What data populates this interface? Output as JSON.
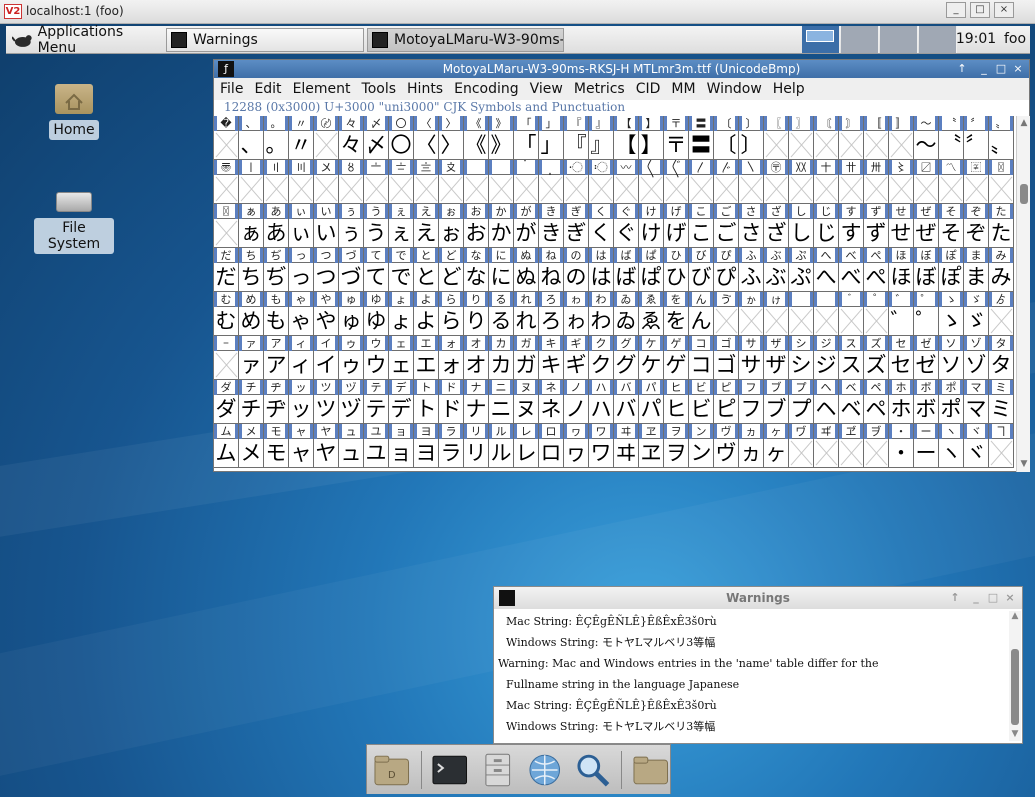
{
  "vnc": {
    "title": "localhost:1 (foo)",
    "logo": "V2"
  },
  "panel": {
    "apps_label": "Applications Menu",
    "tasks": [
      {
        "label": "Warnings"
      },
      {
        "label": "MotoyaLMaru-W3-90ms-…"
      }
    ],
    "clock": "19:01",
    "user": "foo"
  },
  "desktop_icons": [
    {
      "label": "Home"
    },
    {
      "label": "File System"
    }
  ],
  "font_window": {
    "title": "MotoyaLMaru-W3-90ms-RKSJ-H  MTLmr3m.ttf (UnicodeBmp)",
    "menu": [
      "File",
      "Edit",
      "Element",
      "Tools",
      "Hints",
      "Encoding",
      "View",
      "Metrics",
      "CID",
      "MM",
      "Window",
      "Help"
    ],
    "info_line": "12288 (0x3000) U+3000 \"uni3000\" CJK Symbols and Punctuation",
    "rows": [
      {
        "labels": [
          "�",
          "、",
          "。",
          "〃",
          "〄",
          "々",
          "〆",
          "〇",
          "〈",
          "〉",
          "《",
          "》",
          "「",
          "」",
          "『",
          "』",
          "【",
          "】",
          "〒",
          "〓",
          "〔",
          "〕",
          "〖",
          "〗",
          "〘",
          "〙",
          "〚",
          "〛",
          "〜",
          "〝",
          "〞",
          "〟"
        ],
        "glyphs": [
          "",
          "、",
          "。",
          "〃",
          "",
          "々",
          "〆",
          "〇",
          "〈",
          "〉",
          "《",
          "》",
          "「",
          "」",
          "『",
          "』",
          "【",
          "】",
          "〒",
          "〓",
          "〔",
          "〕",
          "",
          "",
          "",
          "",
          "",
          "",
          "〜",
          "〝",
          "〞",
          "〟"
        ]
      },
      {
        "labels": [
          "〠",
          "〡",
          "〢",
          "〣",
          "〤",
          "〥",
          "〦",
          "〧",
          "〨",
          "〩",
          "〪",
          "〫",
          "〬",
          "〭",
          "〮",
          "〯",
          "〰",
          "〱",
          "〲",
          "〳",
          "〴",
          "〵",
          "〶",
          "〷",
          "〸",
          "〹",
          "〺",
          "〻",
          "〼",
          "〽",
          "〾",
          "〿"
        ],
        "glyphs": [
          "",
          "",
          "",
          "",
          "",
          "",
          "",
          "",
          "",
          "",
          "",
          "",
          "",
          "",
          "",
          "",
          "",
          "",
          "",
          "",
          "",
          "",
          "",
          "",
          "",
          "",
          "",
          "",
          "",
          "",
          "",
          ""
        ]
      },
      {
        "labels": [
          "〿",
          "ぁ",
          "あ",
          "ぃ",
          "い",
          "ぅ",
          "う",
          "ぇ",
          "え",
          "ぉ",
          "お",
          "か",
          "が",
          "き",
          "ぎ",
          "く",
          "ぐ",
          "け",
          "げ",
          "こ",
          "ご",
          "さ",
          "ざ",
          "し",
          "じ",
          "す",
          "ず",
          "せ",
          "ぜ",
          "そ",
          "ぞ",
          "た"
        ],
        "glyphs": [
          "",
          "ぁ",
          "あ",
          "ぃ",
          "い",
          "ぅ",
          "う",
          "ぇ",
          "え",
          "ぉ",
          "お",
          "か",
          "が",
          "き",
          "ぎ",
          "く",
          "ぐ",
          "け",
          "げ",
          "こ",
          "ご",
          "さ",
          "ざ",
          "し",
          "じ",
          "す",
          "ず",
          "せ",
          "ぜ",
          "そ",
          "ぞ",
          "た"
        ]
      },
      {
        "labels": [
          "だ",
          "ち",
          "ぢ",
          "っ",
          "つ",
          "づ",
          "て",
          "で",
          "と",
          "ど",
          "な",
          "に",
          "ぬ",
          "ね",
          "の",
          "は",
          "ば",
          "ぱ",
          "ひ",
          "び",
          "ぴ",
          "ふ",
          "ぶ",
          "ぷ",
          "へ",
          "べ",
          "ぺ",
          "ほ",
          "ぼ",
          "ぽ",
          "ま",
          "み"
        ],
        "glyphs": [
          "だ",
          "ち",
          "ぢ",
          "っ",
          "つ",
          "づ",
          "て",
          "で",
          "と",
          "ど",
          "な",
          "に",
          "ぬ",
          "ね",
          "の",
          "は",
          "ば",
          "ぱ",
          "ひ",
          "び",
          "ぴ",
          "ふ",
          "ぶ",
          "ぷ",
          "へ",
          "べ",
          "ぺ",
          "ほ",
          "ぼ",
          "ぽ",
          "ま",
          "み"
        ]
      },
      {
        "labels": [
          "む",
          "め",
          "も",
          "ゃ",
          "や",
          "ゅ",
          "ゆ",
          "ょ",
          "よ",
          "ら",
          "り",
          "る",
          "れ",
          "ろ",
          "ゎ",
          "わ",
          "ゐ",
          "ゑ",
          "を",
          "ん",
          "ゔ",
          "ゕ",
          "ゖ",
          "゗",
          "゘",
          "゙",
          "゚",
          "゛",
          "゜",
          "ゝ",
          "ゞ",
          "ゟ"
        ],
        "glyphs": [
          "む",
          "め",
          "も",
          "ゃ",
          "や",
          "ゅ",
          "ゆ",
          "ょ",
          "よ",
          "ら",
          "り",
          "る",
          "れ",
          "ろ",
          "ゎ",
          "わ",
          "ゐ",
          "ゑ",
          "を",
          "ん",
          "",
          "",
          "",
          "",
          "",
          "",
          "",
          "゛",
          "゜",
          "ゝ",
          "ゞ",
          ""
        ]
      },
      {
        "labels": [
          "゠",
          "ァ",
          "ア",
          "ィ",
          "イ",
          "ゥ",
          "ウ",
          "ェ",
          "エ",
          "ォ",
          "オ",
          "カ",
          "ガ",
          "キ",
          "ギ",
          "ク",
          "グ",
          "ケ",
          "ゲ",
          "コ",
          "ゴ",
          "サ",
          "ザ",
          "シ",
          "ジ",
          "ス",
          "ズ",
          "セ",
          "ゼ",
          "ソ",
          "ゾ",
          "タ"
        ],
        "glyphs": [
          "",
          "ァ",
          "ア",
          "ィ",
          "イ",
          "ゥ",
          "ウ",
          "ェ",
          "エ",
          "ォ",
          "オ",
          "カ",
          "ガ",
          "キ",
          "ギ",
          "ク",
          "グ",
          "ケ",
          "ゲ",
          "コ",
          "ゴ",
          "サ",
          "ザ",
          "シ",
          "ジ",
          "ス",
          "ズ",
          "セ",
          "ゼ",
          "ソ",
          "ゾ",
          "タ"
        ]
      },
      {
        "labels": [
          "ダ",
          "チ",
          "ヂ",
          "ッ",
          "ツ",
          "ヅ",
          "テ",
          "デ",
          "ト",
          "ド",
          "ナ",
          "ニ",
          "ヌ",
          "ネ",
          "ノ",
          "ハ",
          "バ",
          "パ",
          "ヒ",
          "ビ",
          "ピ",
          "フ",
          "ブ",
          "プ",
          "ヘ",
          "ベ",
          "ペ",
          "ホ",
          "ボ",
          "ポ",
          "マ",
          "ミ"
        ],
        "glyphs": [
          "ダ",
          "チ",
          "ヂ",
          "ッ",
          "ツ",
          "ヅ",
          "テ",
          "デ",
          "ト",
          "ド",
          "ナ",
          "ニ",
          "ヌ",
          "ネ",
          "ノ",
          "ハ",
          "バ",
          "パ",
          "ヒ",
          "ビ",
          "ピ",
          "フ",
          "ブ",
          "プ",
          "ヘ",
          "ベ",
          "ペ",
          "ホ",
          "ボ",
          "ポ",
          "マ",
          "ミ"
        ]
      },
      {
        "labels": [
          "ム",
          "メ",
          "モ",
          "ャ",
          "ヤ",
          "ュ",
          "ユ",
          "ョ",
          "ヨ",
          "ラ",
          "リ",
          "ル",
          "レ",
          "ロ",
          "ヮ",
          "ワ",
          "ヰ",
          "ヱ",
          "ヲ",
          "ン",
          "ヴ",
          "ヵ",
          "ヶ",
          "ヷ",
          "ヸ",
          "ヹ",
          "ヺ",
          "・",
          "ー",
          "ヽ",
          "ヾ",
          "ヿ"
        ],
        "glyphs": [
          "ム",
          "メ",
          "モ",
          "ャ",
          "ヤ",
          "ュ",
          "ユ",
          "ョ",
          "ヨ",
          "ラ",
          "リ",
          "ル",
          "レ",
          "ロ",
          "ヮ",
          "ワ",
          "ヰ",
          "ヱ",
          "ヲ",
          "ン",
          "ヴ",
          "ヵ",
          "ヶ",
          "",
          "",
          "",
          "",
          "・",
          "ー",
          "ヽ",
          "ヾ",
          ""
        ]
      }
    ]
  },
  "warnings_window": {
    "title": "Warnings",
    "lines": [
      {
        "text": "Mac String: ÊÇÊgÊÑLÊ}ÊßÊxÊ3š0rù",
        "indent": true
      },
      {
        "text": "Windows String: モトヤLマルベリ3等幅",
        "indent": true
      },
      {
        "text": "Warning: Mac and Windows entries in the 'name' table differ for the",
        "indent": false
      },
      {
        "text": "Fullname string in the language Japanese",
        "indent": true
      },
      {
        "text": "Mac String: ÊÇÊgÊÑLÊ}ÊßÊxÊ3š0rù",
        "indent": true
      },
      {
        "text": "Windows String: モトヤLマルベリ3等幅",
        "indent": true
      }
    ]
  },
  "dock": {
    "items": [
      "file-manager-icon",
      "terminal-icon",
      "file-cabinet-icon",
      "web-browser-icon",
      "search-icon",
      "folder-icon"
    ]
  },
  "colors": {
    "panel_active_workspace": "#3b6ea8",
    "title_bar_blue": "#4a7cb8",
    "glyph_label_marker": "#5b7fc0"
  }
}
